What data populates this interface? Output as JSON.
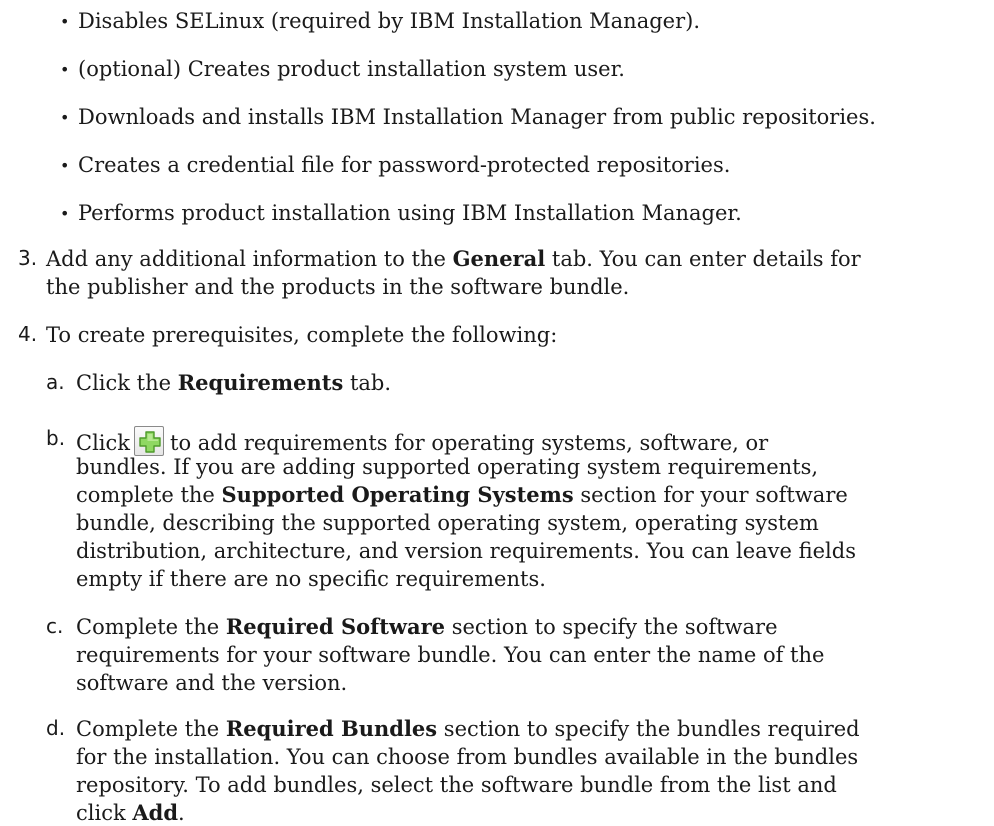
{
  "bullets": [
    "Disables SELinux (required by IBM Installation Manager).",
    "(optional) Creates product installation system user.",
    "Downloads and installs IBM Installation Manager from public repositories.",
    "Creates a credential file for password-protected repositories.",
    "Performs product installation using IBM Installation Manager."
  ],
  "step3": {
    "num": "3.",
    "pre": "Add any additional information to the ",
    "bold": "General",
    "post": " tab. You can enter details for",
    "line2": "the publisher and the products in the software bundle."
  },
  "step4": {
    "num": "4.",
    "text": "To create prerequisites, complete the following:"
  },
  "sub_a": {
    "label": "a.",
    "pre": "Click the ",
    "bold": "Requirements",
    "post": " tab."
  },
  "sub_b": {
    "label": "b.",
    "click": "Click",
    "after_icon": "to add requirements for operating systems, software, or",
    "line2": "bundles. If you are adding supported operating system requirements,",
    "line3_pre": "complete the ",
    "line3_bold": "Supported Operating Systems",
    "line3_post": " section for your software",
    "line4": "bundle, describing the supported operating system, operating system",
    "line5": "distribution, architecture, and version requirements. You can leave fields",
    "line6": "empty if there are no specific requirements.",
    "icon": "add-plus-icon",
    "icon_color": "#6cc43a"
  },
  "sub_c": {
    "label": "c.",
    "pre": "Complete the ",
    "bold": "Required Software",
    "post": " section to specify the software",
    "line2": "requirements for your software bundle. You can enter the name of the",
    "line3": "software and the version."
  },
  "sub_d": {
    "label": "d.",
    "pre": "Complete the ",
    "bold": "Required Bundles",
    "post": " section to specify the bundles required",
    "line2": "for the installation. You can choose from bundles available in the bundles",
    "line3": "repository. To add bundles, select the software bundle from the list and",
    "line4_pre": "click ",
    "line4_bold": "Add",
    "line4_post": "."
  }
}
